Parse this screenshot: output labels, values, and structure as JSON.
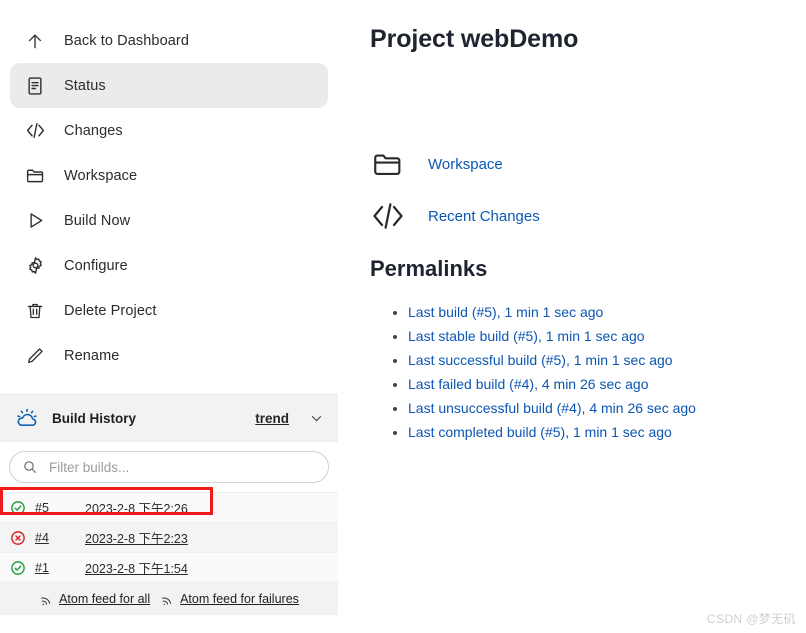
{
  "sidebar": {
    "tasks": [
      {
        "label": "Back to Dashboard",
        "icon": "arrow-up-icon",
        "active": false
      },
      {
        "label": "Status",
        "icon": "document-icon",
        "active": true
      },
      {
        "label": "Changes",
        "icon": "code-brackets-icon",
        "active": false
      },
      {
        "label": "Workspace",
        "icon": "folder-icon",
        "active": false
      },
      {
        "label": "Build Now",
        "icon": "play-icon",
        "active": false
      },
      {
        "label": "Configure",
        "icon": "gear-icon",
        "active": false
      },
      {
        "label": "Delete Project",
        "icon": "trash-icon",
        "active": false
      },
      {
        "label": "Rename",
        "icon": "pencil-icon",
        "active": false
      }
    ],
    "build_history": {
      "title": "Build History",
      "icon": "weather-cloud-icon",
      "trend_label": "trend",
      "caret_icon": "chevron-down-icon",
      "filter": {
        "placeholder": "Filter builds...",
        "value": "",
        "icon": "search-icon"
      },
      "builds": [
        {
          "status": "success",
          "number": "#5",
          "time": "2023-2-8 下午2:26",
          "highlighted": true
        },
        {
          "status": "failed",
          "number": "#4",
          "time": "2023-2-8 下午2:23",
          "highlighted": false
        },
        {
          "status": "success",
          "number": "#1",
          "time": "2023-2-8 下午1:54",
          "highlighted": false
        }
      ],
      "feeds": [
        {
          "label": "Atom feed for all",
          "icon": "rss-icon"
        },
        {
          "label": "Atom feed for failures",
          "icon": "rss-icon"
        }
      ]
    }
  },
  "main": {
    "title": "Project webDemo",
    "shortcuts": [
      {
        "label": "Workspace",
        "icon": "folder-icon"
      },
      {
        "label": "Recent Changes",
        "icon": "code-brackets-icon"
      }
    ],
    "permalinks_heading": "Permalinks",
    "permalinks": [
      "Last build (#5), 1 min 1 sec ago",
      "Last stable build (#5), 1 min 1 sec ago",
      "Last successful build (#5), 1 min 1 sec ago",
      "Last failed build (#4), 4 min 26 sec ago",
      "Last unsuccessful build (#4), 4 min 26 sec ago",
      "Last completed build (#5), 1 min 1 sec ago"
    ]
  },
  "watermark": "CSDN @梦无矶",
  "colors": {
    "link": "#0b57b3",
    "success": "#1f9d3a",
    "failure": "#d32020",
    "highlight_box": "#f01b1b",
    "panel_header": "#f2f2f2",
    "active_item": "#ebebeb"
  }
}
